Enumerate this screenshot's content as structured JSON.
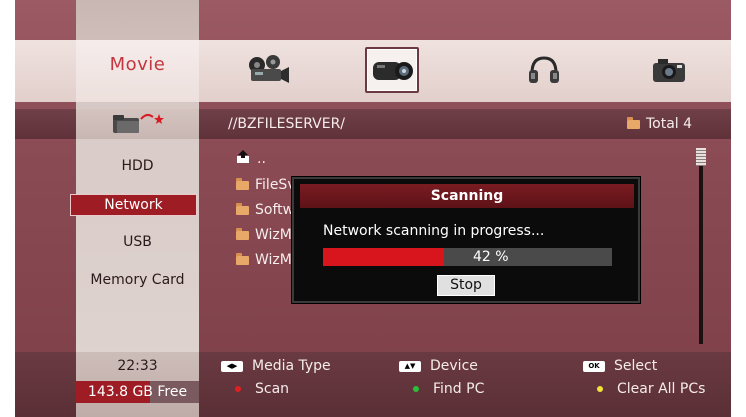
{
  "header": {
    "media_type_title": "Movie",
    "media_icons": [
      {
        "name": "movie-reel-icon",
        "selected": false
      },
      {
        "name": "video-camera-icon",
        "selected": true
      },
      {
        "name": "headphones-icon",
        "selected": false
      },
      {
        "name": "photo-camera-icon",
        "selected": false
      }
    ]
  },
  "path_bar": {
    "path": "//BZFILESERVER/",
    "total": "Total 4"
  },
  "devices": [
    {
      "label": "HDD",
      "active": false
    },
    {
      "label": "Network",
      "active": true
    },
    {
      "label": "USB",
      "active": false
    },
    {
      "label": "Memory Card",
      "active": false
    }
  ],
  "files": [
    {
      "label": "..",
      "icon": "up-folder-icon"
    },
    {
      "label": "FileSvr",
      "icon": "folder-icon"
    },
    {
      "label": "Softwa",
      "icon": "folder-icon"
    },
    {
      "label": "WizMe",
      "icon": "folder-icon"
    },
    {
      "label": "WizMe",
      "icon": "folder-icon"
    }
  ],
  "dialog": {
    "title": "Scanning",
    "message": "Network scanning in progress...",
    "progress_value": 0.42,
    "progress_text": "42 %",
    "stop_label": "Stop"
  },
  "footer": {
    "clock": "22:33",
    "free_space": "143.8 GB Free",
    "help": {
      "media_type": "Media Type",
      "device": "Device",
      "select": "Select",
      "scan": "Scan",
      "find_pc": "Find PC",
      "clear_all_pcs": "Clear All PCs",
      "ok_key": "OK"
    }
  },
  "colors": {
    "accent_red": "#d8151d",
    "scan_dot": "#e02020",
    "find_pc_dot": "#2bbf3a",
    "clear_dot": "#f2e23a"
  }
}
